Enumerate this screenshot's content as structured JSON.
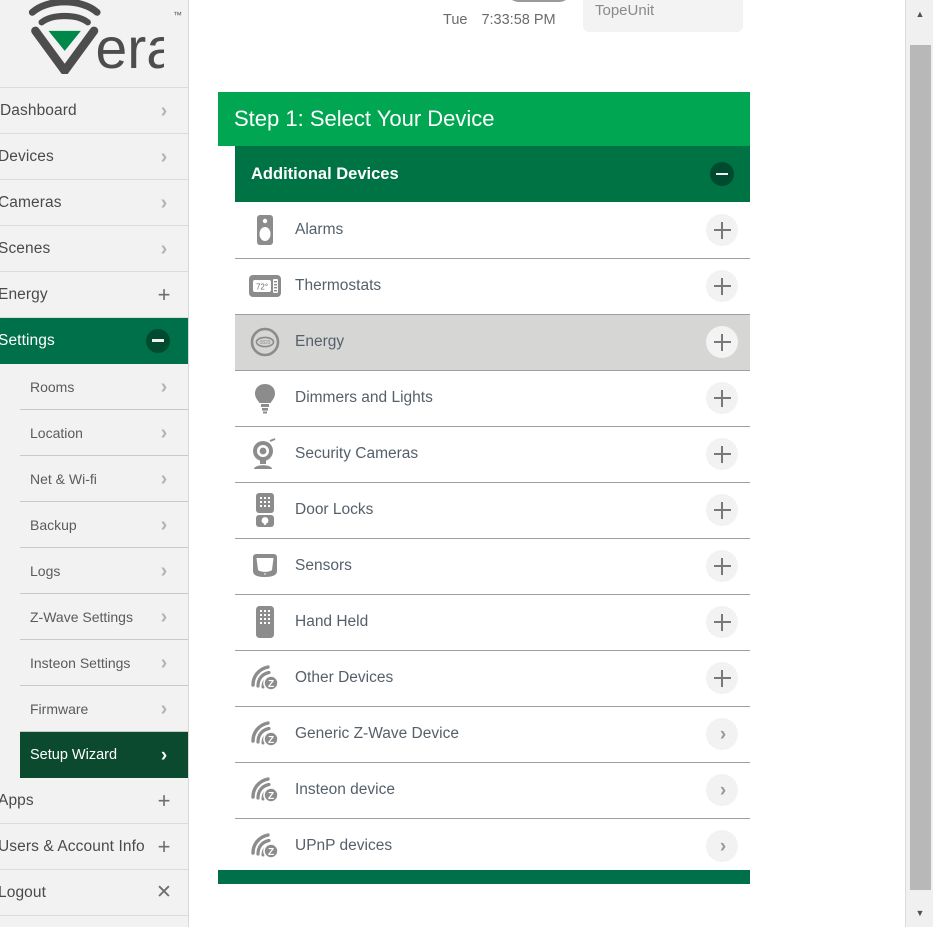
{
  "brand": {
    "name": "vera",
    "tm": "™"
  },
  "sidebar": {
    "top_items": [
      {
        "label": "Dashboard",
        "icon": "chevron-right-icon",
        "key": "dashboard"
      },
      {
        "label": "Devices",
        "icon": "chevron-right-icon",
        "key": "devices"
      },
      {
        "label": "Cameras",
        "icon": "chevron-right-icon",
        "key": "cameras"
      },
      {
        "label": "Scenes",
        "icon": "chevron-right-icon",
        "key": "scenes"
      },
      {
        "label": "Energy",
        "icon": "plus-icon",
        "key": "energy"
      }
    ],
    "settings": {
      "label": "Settings",
      "icon": "circle-minus-icon",
      "expanded": true,
      "sub_items": [
        {
          "label": "Rooms",
          "icon": "chevron-right-icon",
          "active": false
        },
        {
          "label": "Location",
          "icon": "chevron-right-icon",
          "active": false
        },
        {
          "label": "Net & Wi-fi",
          "icon": "chevron-right-icon",
          "active": false
        },
        {
          "label": "Backup",
          "icon": "chevron-right-icon",
          "active": false
        },
        {
          "label": "Logs",
          "icon": "chevron-right-icon",
          "active": false
        },
        {
          "label": "Z-Wave Settings",
          "icon": "chevron-right-icon",
          "active": false
        },
        {
          "label": "Insteon Settings",
          "icon": "chevron-right-icon",
          "active": false
        },
        {
          "label": "Firmware",
          "icon": "chevron-right-icon",
          "active": false
        },
        {
          "label": "Setup Wizard",
          "icon": "chevron-right-icon",
          "active": true
        }
      ]
    },
    "bottom_items": [
      {
        "label": "Apps",
        "icon": "plus-icon",
        "key": "apps"
      },
      {
        "label": "Users & Account Info",
        "icon": "plus-icon",
        "key": "users-account-info"
      },
      {
        "label": "Logout",
        "icon": "close-x-icon",
        "key": "logout"
      }
    ]
  },
  "topbar": {
    "day": "Tue",
    "time": "7:33:58 PM",
    "unit_name": "TopeUnit"
  },
  "step": {
    "title": "Step 1: Select Your Device"
  },
  "section": {
    "title": "Additional Devices",
    "collapse_icon": "circle-minus-icon"
  },
  "devices": [
    {
      "label": "Alarms",
      "icon": "alarm-sensor-icon",
      "action": "plus",
      "selected": false
    },
    {
      "label": "Thermostats",
      "icon": "thermostat-icon",
      "action": "plus",
      "selected": false,
      "icon_text": "72°"
    },
    {
      "label": "Energy",
      "icon": "energy-meter-icon",
      "action": "plus",
      "selected": true
    },
    {
      "label": "Dimmers and Lights",
      "icon": "lightbulb-icon",
      "action": "plus",
      "selected": false
    },
    {
      "label": "Security Cameras",
      "icon": "camera-icon",
      "action": "plus",
      "selected": false
    },
    {
      "label": "Door Locks",
      "icon": "door-lock-icon",
      "action": "plus",
      "selected": false
    },
    {
      "label": "Sensors",
      "icon": "sensor-icon",
      "action": "plus",
      "selected": false
    },
    {
      "label": "Hand Held",
      "icon": "remote-control-icon",
      "action": "plus",
      "selected": false
    },
    {
      "label": "Other Devices",
      "icon": "zwave-icon",
      "action": "plus",
      "selected": false
    },
    {
      "label": "Generic Z-Wave Device",
      "icon": "zwave-icon",
      "action": "chevron",
      "selected": false
    },
    {
      "label": "Insteon device",
      "icon": "zwave-icon",
      "action": "chevron",
      "selected": false
    },
    {
      "label": "UPnP devices",
      "icon": "zwave-icon",
      "action": "chevron",
      "selected": false
    }
  ],
  "scrollbar": {
    "up_icon": "triangle-up-icon",
    "down_icon": "triangle-down-icon"
  },
  "annotation": {
    "type": "arrow",
    "color": "#e2483f",
    "points_at": "Energy row plus button"
  },
  "colors": {
    "green_light": "#00a651",
    "green_dark": "#007344",
    "green_deep": "#00704a",
    "sidebar_bg": "#f2f2f2",
    "row_selected": "#d6d6d4",
    "annotation_red": "#e2483f"
  }
}
